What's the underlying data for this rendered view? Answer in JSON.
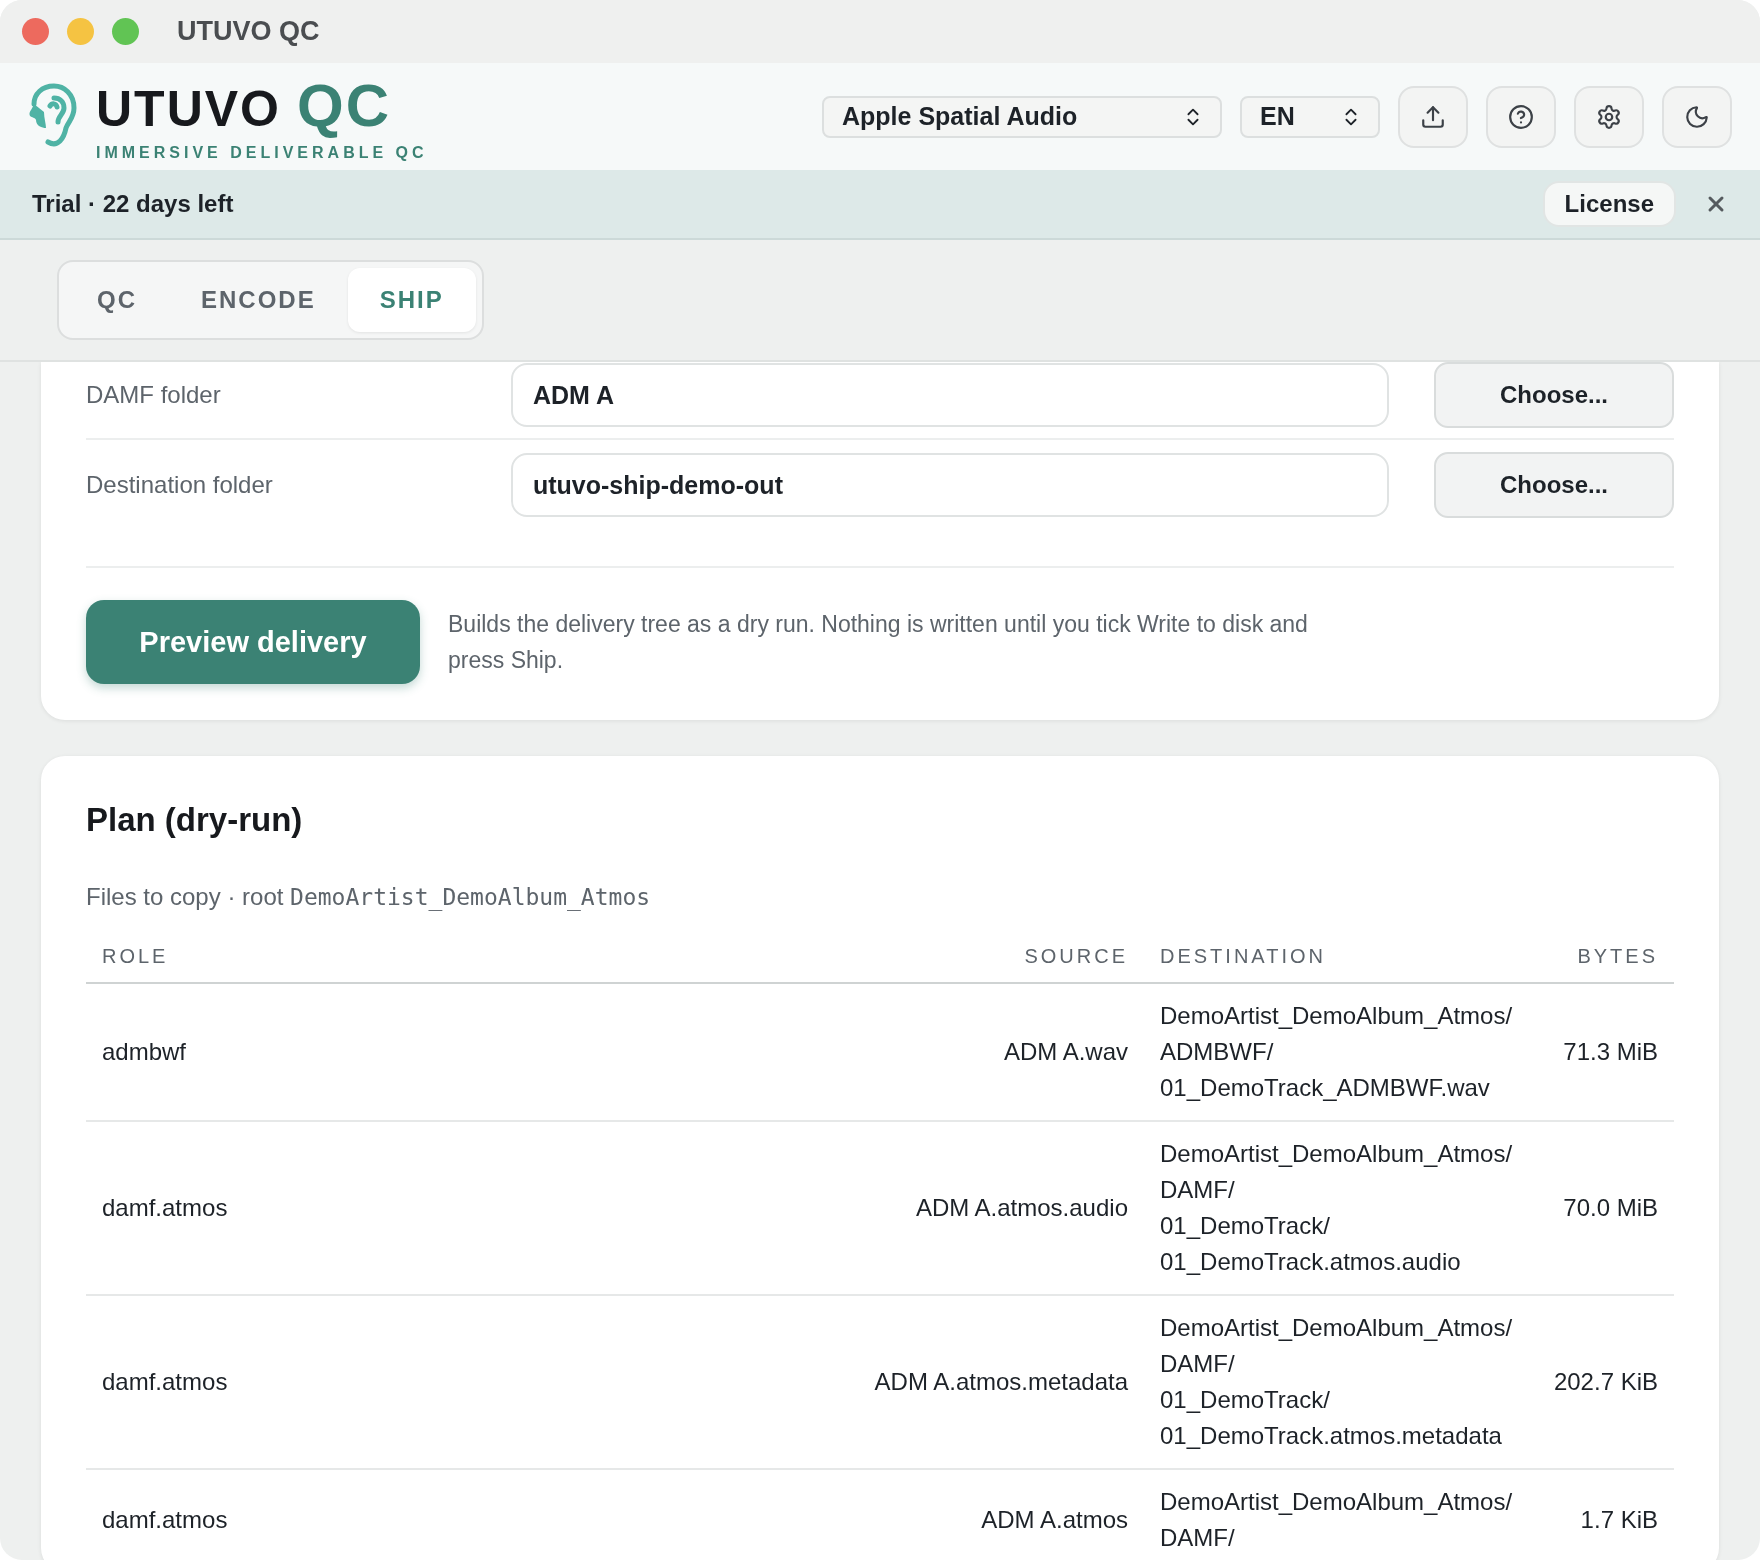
{
  "window": {
    "title": "UTUVO QC"
  },
  "header": {
    "wordmark": "UTUVO",
    "wordmark_accent": "QC",
    "tagline": "IMMERSIVE DELIVERABLE QC",
    "selects": [
      {
        "value": "Apple Spatial Audio"
      },
      {
        "value": "EN"
      }
    ]
  },
  "trial_banner": {
    "text": "Trial · 22 days left",
    "button": "License"
  },
  "tabs": [
    {
      "label": "QC",
      "selected": false
    },
    {
      "label": "ENCODE",
      "selected": false
    },
    {
      "label": "SHIP",
      "selected": true
    }
  ],
  "folders": [
    {
      "label": "DAMF folder",
      "value": "ADM A",
      "button": "Choose..."
    },
    {
      "label": "Destination folder",
      "value": "utuvo-ship-demo-out",
      "button": "Choose..."
    }
  ],
  "preview": {
    "button": "Preview delivery",
    "description": "Builds the delivery tree as a dry run. Nothing is written until you tick Write to disk and press Ship."
  },
  "plan": {
    "title": "Plan (dry-run)",
    "subtitle": "Files to copy · root",
    "root": "DemoArtist_DemoAlbum_Atmos",
    "table": {
      "columns": [
        "ROLE",
        "SOURCE",
        "DESTINATION",
        "BYTES"
      ],
      "rows": [
        {
          "role": "admbwf",
          "source": "ADM A.wav",
          "destination": [
            "DemoArtist_DemoAlbum_Atmos/",
            "ADMBWF/",
            "01_DemoTrack_ADMBWF.wav"
          ],
          "bytes": "71.3 MiB"
        },
        {
          "role": "damf.atmos",
          "source": "ADM A.atmos.audio",
          "destination": [
            "DemoArtist_DemoAlbum_Atmos/",
            "DAMF/",
            "01_DemoTrack/",
            "01_DemoTrack.atmos.audio"
          ],
          "bytes": "70.0 MiB"
        },
        {
          "role": "damf.atmos",
          "source": "ADM A.atmos.metadata",
          "destination": [
            "DemoArtist_DemoAlbum_Atmos/",
            "DAMF/",
            "01_DemoTrack/",
            "01_DemoTrack.atmos.metadata"
          ],
          "bytes": "202.7 KiB"
        },
        {
          "role": "damf.atmos",
          "source": "ADM A.atmos",
          "destination": [
            "DemoArtist_DemoAlbum_Atmos/",
            "DAMF/"
          ],
          "bytes": "1.7 KiB"
        }
      ]
    }
  }
}
